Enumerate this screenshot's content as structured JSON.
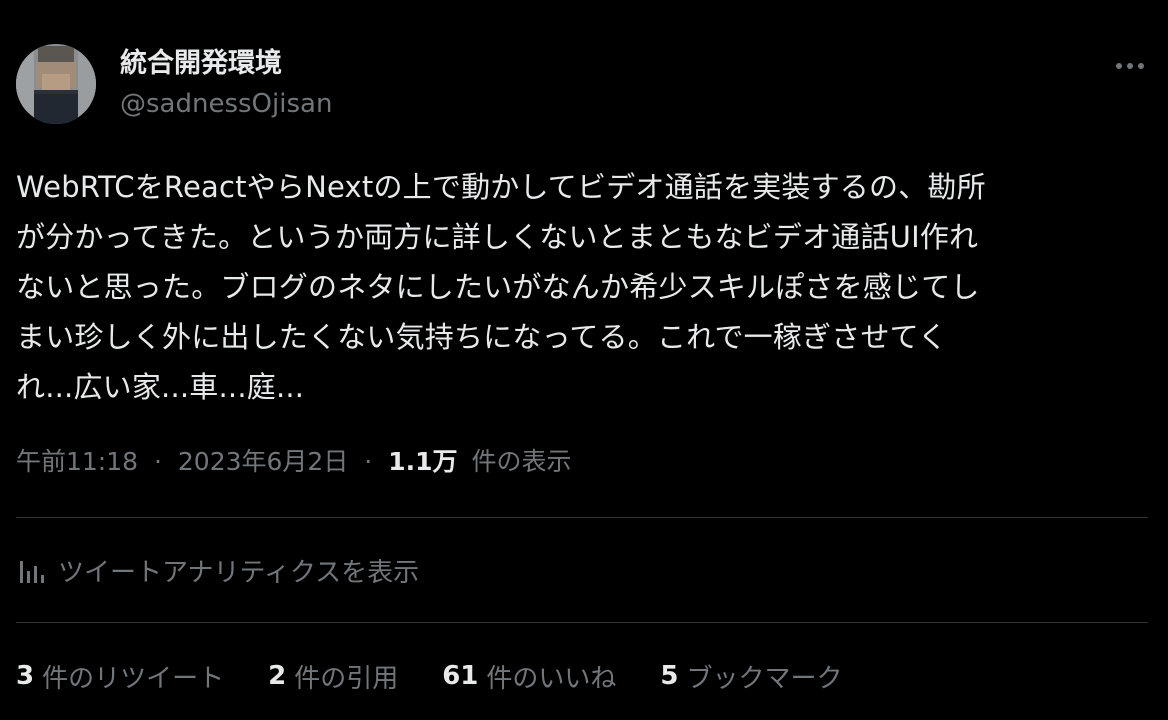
{
  "author": {
    "display_name": "統合開発環境",
    "handle": "@sadnessOjisan"
  },
  "tweet": {
    "text": "WebRTCをReactやらNextの上で動かしてビデオ通話を実装するの、勘所\nが分かってきた。というか両方に詳しくないとまともなビデオ通話UI作れ\nないと思った。ブログのネタにしたいがなんか希少スキルぽさを感じてし\nまい珍しく外に出したくない気持ちになってる。これで一稼ぎさせてく\nれ...広い家...車...庭..."
  },
  "meta": {
    "time": "午前11:18",
    "separator": "·",
    "date": "2023年6月2日",
    "views_count": "1.1万",
    "views_label": "件の表示"
  },
  "analytics": {
    "label": "ツイートアナリティクスを表示",
    "icon": "bar-chart-icon"
  },
  "stats": {
    "retweets": {
      "count": "3",
      "label": "件のリツイート"
    },
    "quotes": {
      "count": "2",
      "label": "件の引用"
    },
    "likes": {
      "count": "61",
      "label": "件のいいね"
    },
    "bookmarks": {
      "count": "5",
      "label": "ブックマーク"
    }
  },
  "more_icon": "more-horizontal-icon",
  "colors": {
    "background": "#000000",
    "primary_text": "#e7e9ea",
    "secondary_text": "#71767b",
    "divider": "#2f3336"
  }
}
